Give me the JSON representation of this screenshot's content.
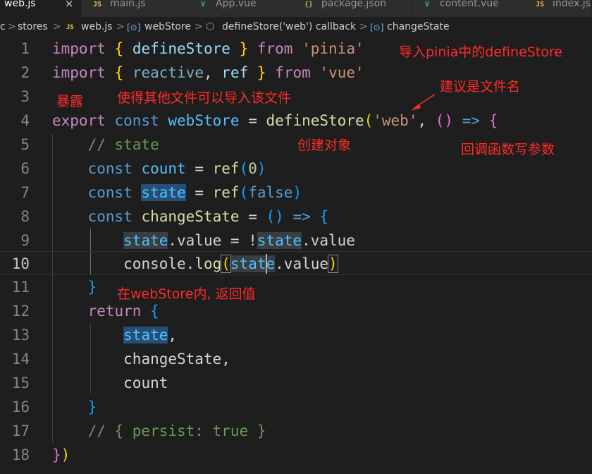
{
  "tabs": [
    {
      "icon": "JS",
      "label": "web.js",
      "active": true
    },
    {
      "icon": "JS",
      "label": "main.js"
    },
    {
      "icon": "V",
      "label": "App.vue"
    },
    {
      "icon": "{}",
      "label": "package.json"
    },
    {
      "icon": "V",
      "label": "content.vue"
    },
    {
      "icon": "JS",
      "label": "index.js"
    }
  ],
  "tab_close": "×",
  "breadcrumb": {
    "seg0": "c",
    "seg1": "stores",
    "seg2_icon": "JS",
    "seg2": "web.js",
    "seg3_icon": "[⊙]",
    "seg3": "webStore",
    "seg4_icon": "⬡",
    "seg4": "defineStore('web') callback",
    "seg5_icon": "[⊙]",
    "seg5": "changeState",
    "separator": ">"
  },
  "line_numbers": [
    "1",
    "2",
    "3",
    "4",
    "5",
    "6",
    "7",
    "8",
    "9",
    "10",
    "11",
    "12",
    "13",
    "14",
    "15",
    "16",
    "17",
    "18"
  ],
  "current_line": "10",
  "code": {
    "l1": {
      "import": "import",
      "ob": "{",
      "name": "defineStore",
      "cb": "}",
      "from": "from",
      "src": "'pinia'"
    },
    "l2": {
      "import": "import",
      "ob": "{",
      "a": "reactive",
      "comma": ",",
      "b": "ref",
      "cb": "}",
      "from": "from",
      "src": "'vue'"
    },
    "l4": {
      "export": "export",
      "const": "const",
      "name": "webStore",
      "eq": "=",
      "fn": "defineStore",
      "p1": "(",
      "arg": "'web'",
      "comma": ",",
      "p2": "()",
      "arrow": "=>",
      "ob": "{"
    },
    "l5": {
      "comment": "// state"
    },
    "l6": {
      "const": "const",
      "name": "count",
      "eq": "=",
      "fn": "ref",
      "p1": "(",
      "num": "0",
      "p2": ")"
    },
    "l7": {
      "const": "const",
      "name": "state",
      "eq": "=",
      "fn": "ref",
      "p1": "(",
      "val": "false",
      "p2": ")"
    },
    "l8": {
      "const": "const",
      "name": "changeState",
      "eq": "=",
      "p": "()",
      "arrow": "=>",
      "ob": "{"
    },
    "l9": {
      "a": "state",
      "a_prop": ".value",
      "eq": "=",
      "not": "!",
      "b": "state",
      "b_prop": ".value"
    },
    "l10": {
      "obj": "console",
      "dot": ".",
      "fn": "log",
      "p1": "(",
      "arg_a": "sta",
      "arg_b": "te",
      "prop": ".value",
      "p2": ")"
    },
    "l11": {
      "cb": "}"
    },
    "l12": {
      "ret": "return",
      "ob": "{"
    },
    "l13": {
      "item": "state",
      "comma": ","
    },
    "l14": {
      "item": "changeState",
      "comma": ","
    },
    "l15": {
      "item": "count"
    },
    "l16": {
      "cb": "}"
    },
    "l17": {
      "comment": "// { persist: true }"
    },
    "l18": {
      "cb": "}",
      "cp": ")"
    }
  },
  "annotations": {
    "a1": "导入pinia中的defineStore",
    "a2": "建议是文件名",
    "a3": "暴露",
    "a4": "使得其他文件可以导入该文件",
    "a5": "创建对象",
    "a6": "回调函数写参数",
    "a7": "在webStore内, 返回值"
  },
  "colors": {
    "editor_bg": "#1e1e1e",
    "keyword": "#569cd6",
    "control_keyword": "#c586c0",
    "variable": "#9cdcfe",
    "constant": "#4fc1ff",
    "function": "#dcdcaa",
    "string": "#ce9178",
    "number": "#b5cea8",
    "comment": "#6a9955",
    "annotation": "#ff2a2a"
  }
}
